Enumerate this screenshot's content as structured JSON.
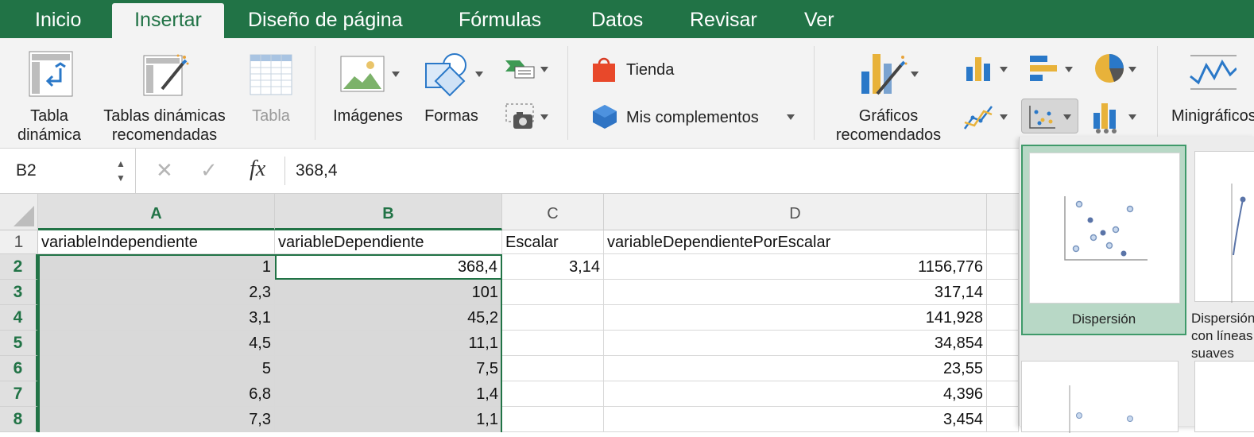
{
  "tabs": [
    {
      "label": "Inicio",
      "active": false
    },
    {
      "label": "Insertar",
      "active": true
    },
    {
      "label": "Diseño de página",
      "active": false
    },
    {
      "label": "Fórmulas",
      "active": false
    },
    {
      "label": "Datos",
      "active": false
    },
    {
      "label": "Revisar",
      "active": false
    },
    {
      "label": "Ver",
      "active": false
    }
  ],
  "ribbon": {
    "tabla_dinamica": "Tabla\ndinámica",
    "tablas_recomendadas": "Tablas dinámicas\nrecomendadas",
    "tabla": "Tabla",
    "imagenes": "Imágenes",
    "formas": "Formas",
    "tienda": "Tienda",
    "mis_complementos": "Mis complementos",
    "graficos_recomendados": "Gráficos\nrecomendados",
    "minigraficos": "Minigráficos"
  },
  "formula_bar": {
    "name_box": "B2",
    "fx": "fx",
    "value": "368,4"
  },
  "grid": {
    "columns": [
      "A",
      "B",
      "C",
      "D"
    ],
    "rows": [
      {
        "n": "1",
        "cells": [
          "variableIndependiente",
          "variableDependiente",
          "Escalar",
          "variableDependientePorEscalar"
        ]
      },
      {
        "n": "2",
        "cells": [
          "1",
          "368,4",
          "3,14",
          "1156,776"
        ]
      },
      {
        "n": "3",
        "cells": [
          "2,3",
          "101",
          "",
          "317,14"
        ]
      },
      {
        "n": "4",
        "cells": [
          "3,1",
          "45,2",
          "",
          "141,928"
        ]
      },
      {
        "n": "5",
        "cells": [
          "4,5",
          "11,1",
          "",
          "34,854"
        ]
      },
      {
        "n": "6",
        "cells": [
          "5",
          "7,5",
          "",
          "23,55"
        ]
      },
      {
        "n": "7",
        "cells": [
          "6,8",
          "1,4",
          "",
          "4,396"
        ]
      },
      {
        "n": "8",
        "cells": [
          "7,3",
          "1,1",
          "",
          "3,454"
        ]
      }
    ],
    "active_cell": "B2"
  },
  "dropdown": {
    "options": [
      {
        "label": "Dispersión",
        "selected": true
      },
      {
        "label": "Dispersión con líneas suaves",
        "selected": false
      }
    ]
  },
  "colors": {
    "accent": "#217346",
    "selection_fill": "#d9d9d9",
    "dropdown_selected": "#b8d8c6"
  }
}
